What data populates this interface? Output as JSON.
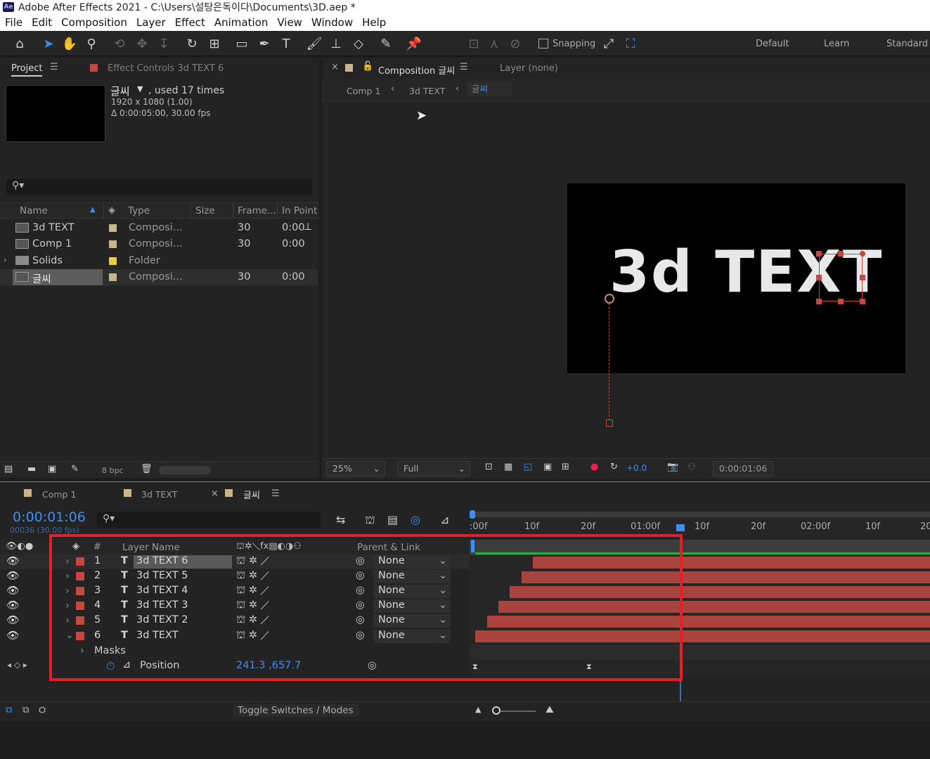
{
  "app": {
    "title": "Adobe After Effects 2021 - C:\\Users\\설탕은독이다\\Documents\\3D.aep *",
    "logo": "Ae"
  },
  "menu": [
    "File",
    "Edit",
    "Composition",
    "Layer",
    "Effect",
    "Animation",
    "View",
    "Window",
    "Help"
  ],
  "toolbar": {
    "snapping_label": "Snapping",
    "workspaces": [
      "Default",
      "Learn",
      "Standard"
    ]
  },
  "project_panel": {
    "tab_label": "Project",
    "effect_controls_label": "Effect Controls 3d TEXT 6",
    "selected_name": "글씨",
    "used_label": ", used 17 times",
    "resolution": "1920 x 1080 (1.00)",
    "duration": "Δ 0:00:05:00, 30.00 fps",
    "columns": [
      "Name",
      "Type",
      "Size",
      "Frame...",
      "In Point"
    ],
    "items": [
      {
        "name": "3d TEXT",
        "type": "Composi...",
        "frame": "30",
        "inpoint": "0:00",
        "color": "#c9b48b"
      },
      {
        "name": "Comp 1",
        "type": "Composi...",
        "frame": "30",
        "inpoint": "0:00",
        "color": "#c9b48b"
      },
      {
        "name": "Solids",
        "type": "Folder",
        "frame": "",
        "inpoint": "",
        "color": "#e7cf3a"
      },
      {
        "name": "글씨",
        "type": "Composi...",
        "frame": "30",
        "inpoint": "0:00",
        "color": "#c9b48b"
      }
    ],
    "bpc": "8 bpc"
  },
  "comp_panel": {
    "tab_label": "Composition 글씨",
    "layer_tab": "Layer (none)",
    "breadcrumbs": [
      "Comp 1",
      "3d TEXT",
      "글씨"
    ],
    "canvas_text": "3d TEXT",
    "zoom": "25%",
    "quality": "Full",
    "exposure": "+0.0",
    "timecode": "0:00:01:06"
  },
  "timeline": {
    "tabs": [
      "Comp 1",
      "3d TEXT",
      "글씨"
    ],
    "timecode": "0:00:01:06",
    "frames": "00036 (30.00 fps)",
    "col_num": "#",
    "col_layer_name": "Layer Name",
    "col_parent": "Parent & Link",
    "ruler": [
      ":00f",
      "10f",
      "20f",
      "01:00f",
      "10f",
      "20f",
      "02:00f",
      "10f",
      "20"
    ],
    "layers": [
      {
        "num": "1",
        "name": "3d TEXT 6",
        "parent": "None"
      },
      {
        "num": "2",
        "name": "3d TEXT 5",
        "parent": "None"
      },
      {
        "num": "3",
        "name": "3d TEXT 4",
        "parent": "None"
      },
      {
        "num": "4",
        "name": "3d TEXT 3",
        "parent": "None"
      },
      {
        "num": "5",
        "name": "3d TEXT 2",
        "parent": "None"
      },
      {
        "num": "6",
        "name": "3d TEXT",
        "parent": "None"
      }
    ],
    "masks_label": "Masks",
    "position_label": "Position",
    "position_value": "241.3 ,657.7",
    "toggle_label": "Toggle Switches / Modes"
  },
  "colors": {
    "accent": "#3d8ef0",
    "layer_red": "#c8463e",
    "highlight_box": "#e3202a",
    "bar": "#a9433d"
  }
}
